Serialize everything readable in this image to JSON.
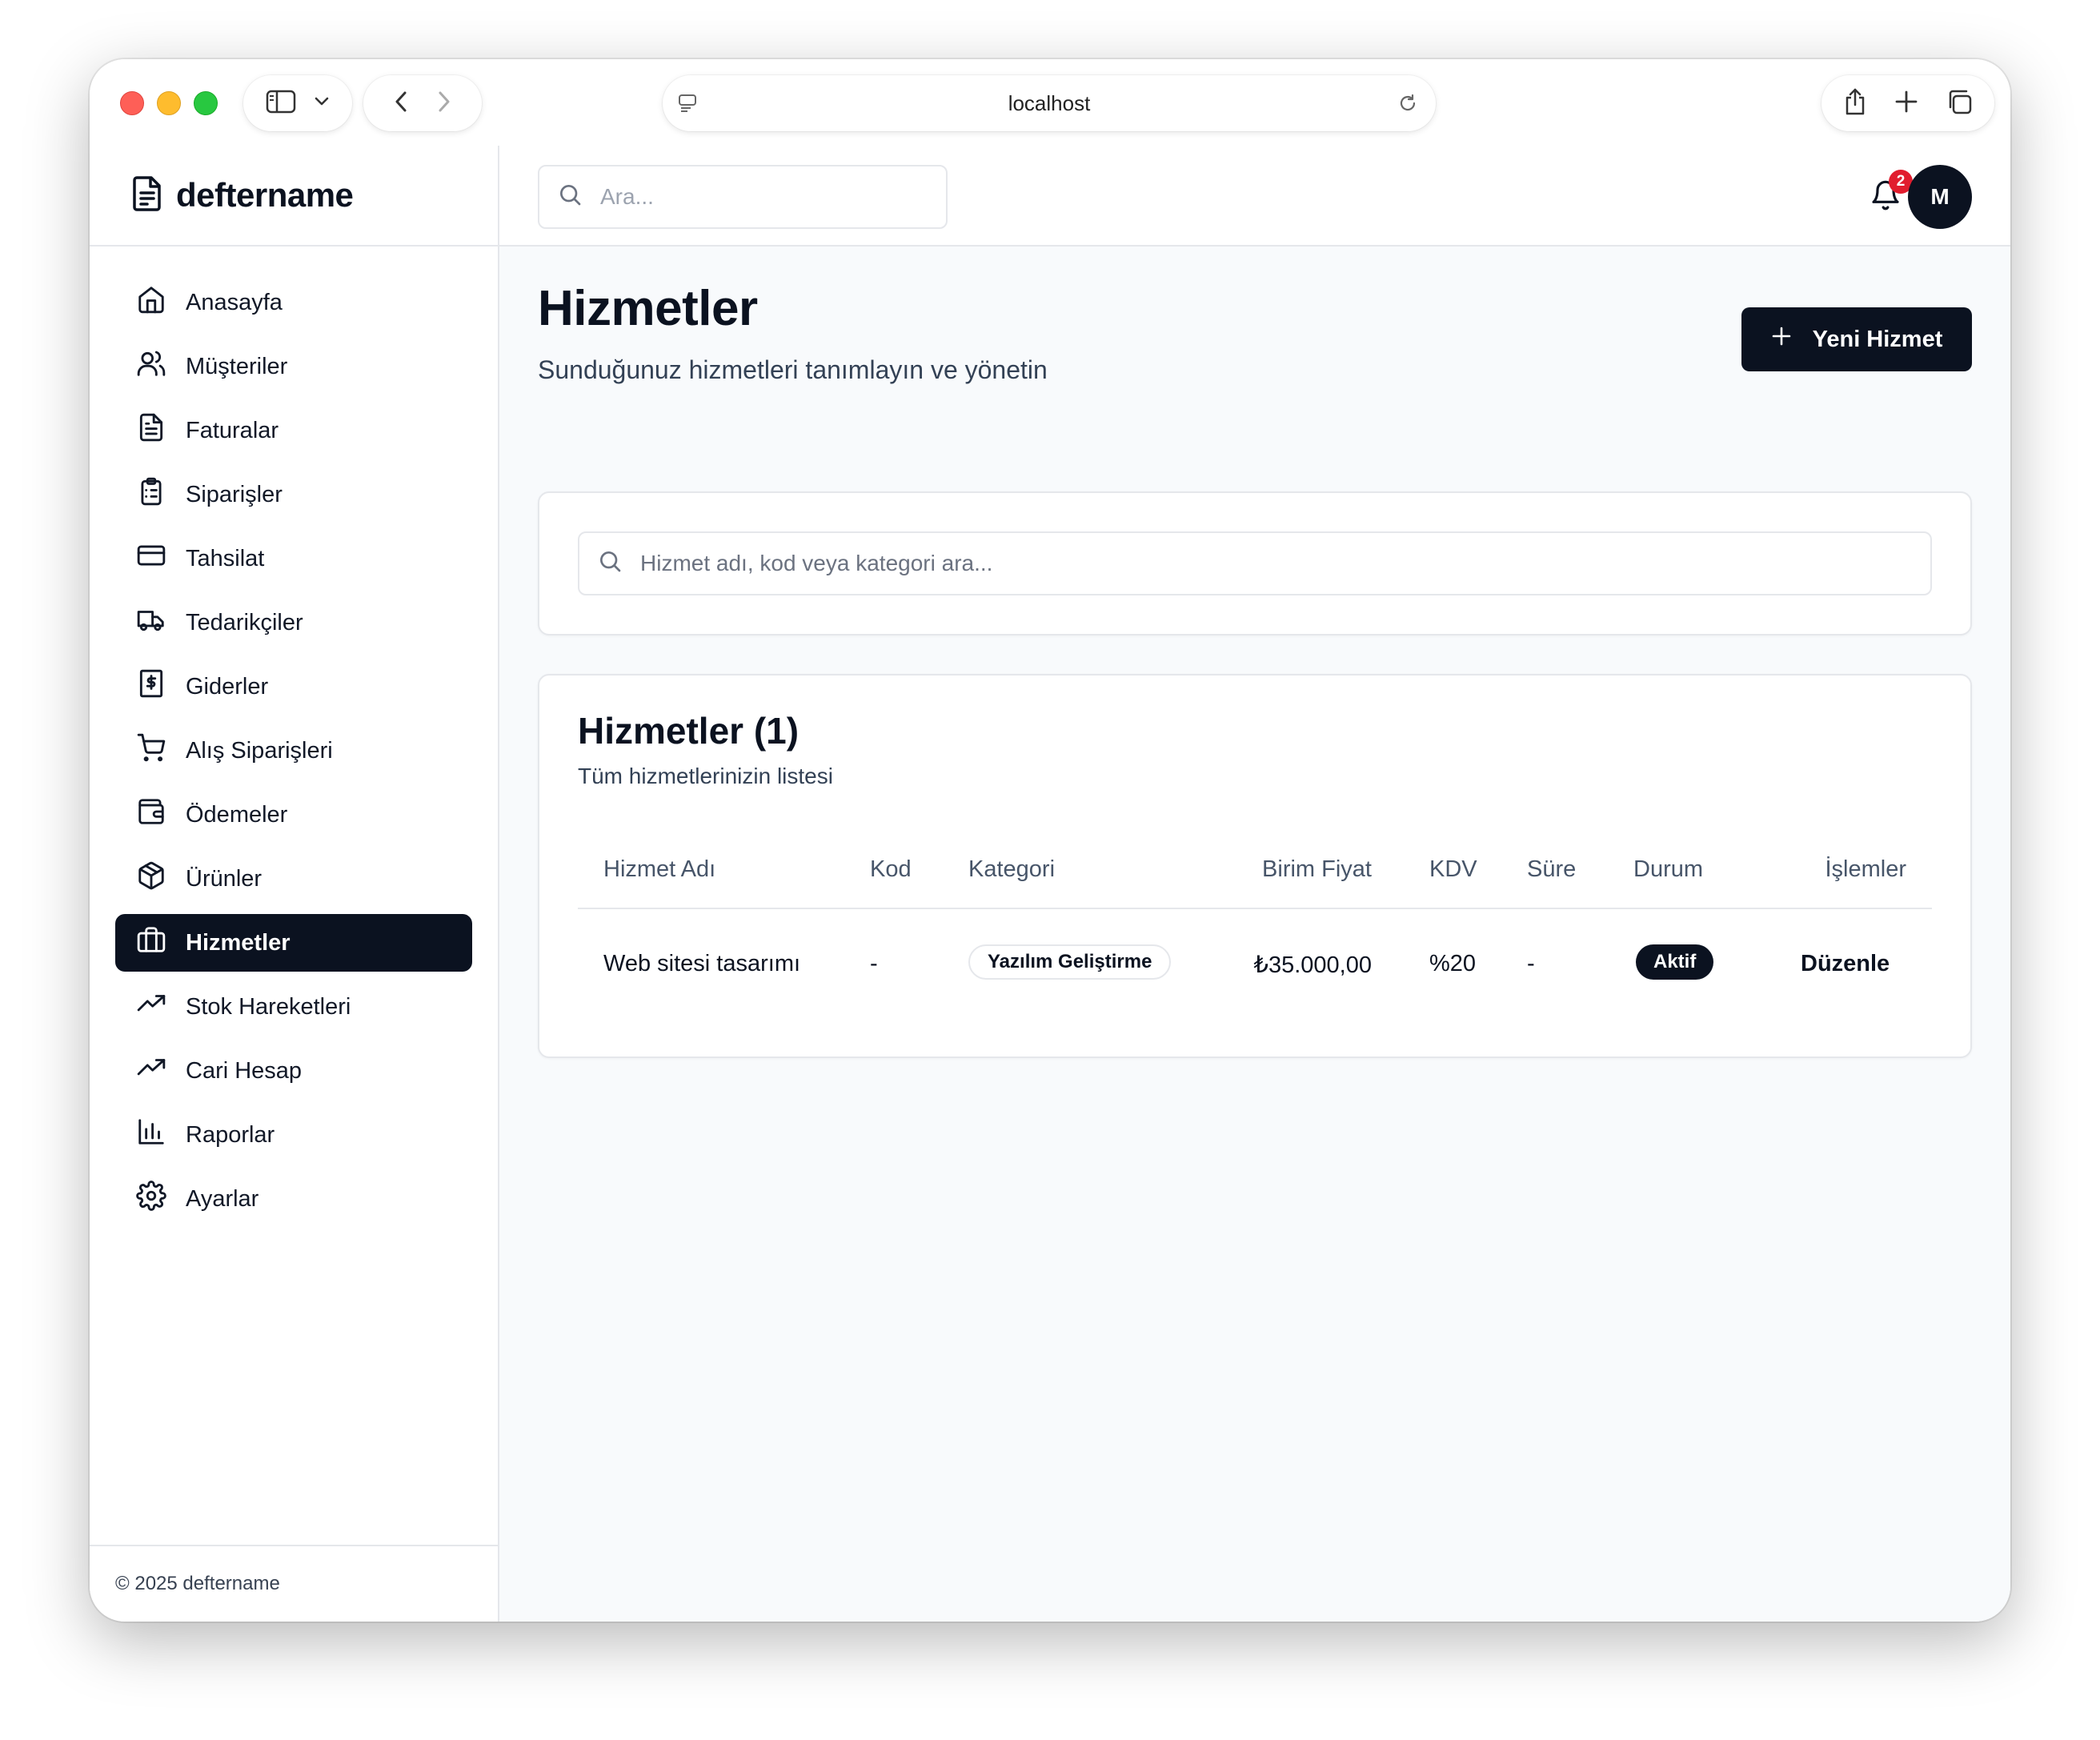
{
  "browser": {
    "url": "localhost"
  },
  "brand": {
    "name": "deftername"
  },
  "sidebar": {
    "items": [
      {
        "label": "Anasayfa",
        "icon": "home-icon"
      },
      {
        "label": "Müşteriler",
        "icon": "users-icon"
      },
      {
        "label": "Faturalar",
        "icon": "file-text-icon"
      },
      {
        "label": "Siparişler",
        "icon": "clipboard-list-icon"
      },
      {
        "label": "Tahsilat",
        "icon": "credit-card-icon"
      },
      {
        "label": "Tedarikçiler",
        "icon": "truck-icon"
      },
      {
        "label": "Giderler",
        "icon": "receipt-icon"
      },
      {
        "label": "Alış Siparişleri",
        "icon": "shopping-cart-icon"
      },
      {
        "label": "Ödemeler",
        "icon": "wallet-icon"
      },
      {
        "label": "Ürünler",
        "icon": "package-icon"
      },
      {
        "label": "Hizmetler",
        "icon": "briefcase-icon",
        "active": true
      },
      {
        "label": "Stok Hareketleri",
        "icon": "trending-up-icon"
      },
      {
        "label": "Cari Hesap",
        "icon": "trending-up-icon"
      },
      {
        "label": "Raporlar",
        "icon": "bar-chart-icon"
      },
      {
        "label": "Ayarlar",
        "icon": "settings-icon"
      }
    ],
    "footer": "© 2025 deftername"
  },
  "topbar": {
    "search_placeholder": "Ara...",
    "notification_count": "2",
    "avatar_initial": "M"
  },
  "page": {
    "title": "Hizmetler",
    "subtitle": "Sunduğunuz hizmetleri tanımlayın ve yönetin",
    "new_button": "Yeni Hizmet"
  },
  "filter": {
    "placeholder": "Hizmet adı, kod veya kategori ara..."
  },
  "table": {
    "title": "Hizmetler (1)",
    "subtitle": "Tüm hizmetlerinizin listesi",
    "columns": [
      "Hizmet Adı",
      "Kod",
      "Kategori",
      "Birim Fiyat",
      "KDV",
      "Süre",
      "Durum",
      "İşlemler"
    ],
    "rows": [
      {
        "name": "Web sitesi tasarımı",
        "code": "-",
        "category": "Yazılım Geliştirme",
        "price": "₺35.000,00",
        "vat": "%20",
        "duration": "-",
        "status": "Aktif",
        "action": "Düzenle"
      }
    ]
  },
  "colors": {
    "primary": "#0b1220",
    "badge": "#e11d2e",
    "background": "#f8fafc"
  }
}
